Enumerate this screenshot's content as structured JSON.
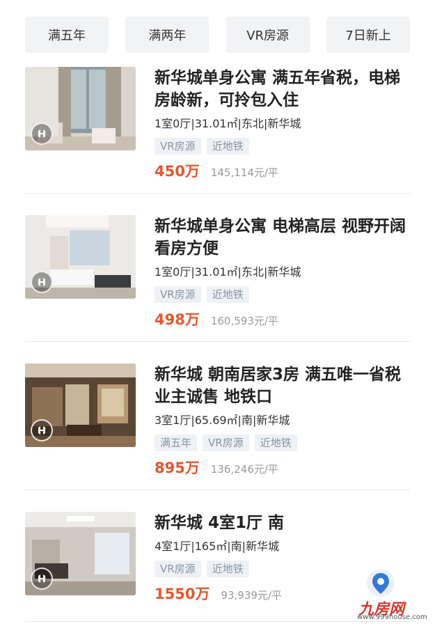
{
  "filters": [
    "满五年",
    "满两年",
    "VR房源",
    "7日新上"
  ],
  "listings": [
    {
      "title": "新华城单身公寓 满五年省税，电梯房龄新，可拎包入住",
      "meta": "1室0厅|31.01㎡|东北|新华城",
      "tags": [
        "VR房源",
        "近地铁"
      ],
      "price": "450万",
      "unit_price": "145,114元/平"
    },
    {
      "title": "新华城单身公寓 电梯高层 视野开阔 看房方便",
      "meta": "1室0厅|31.01㎡|东北|新华城",
      "tags": [
        "VR房源",
        "近地铁"
      ],
      "price": "498万",
      "unit_price": "160,593元/平"
    },
    {
      "title": "新华城 朝南居家3房 满五唯一省税 业主诚售 地铁口",
      "meta": "3室1厅|65.69㎡|南|新华城",
      "tags": [
        "满五年",
        "VR房源",
        "近地铁"
      ],
      "price": "895万",
      "unit_price": "136,246元/平"
    },
    {
      "title": "新华城 4室1厅 南",
      "meta": "4室1厅|165㎡|南|新华城",
      "tags": [
        "VR房源",
        "近地铁"
      ],
      "price": "1550万",
      "unit_price": "93,939元/平"
    }
  ],
  "watermark": {
    "brand": "九房网",
    "url": "www.999house.com"
  },
  "colors": {
    "price": "#e4572e",
    "tag_bg": "#eef1f5",
    "tag_text": "#8a95a5",
    "filter_bg": "#f2f3f5"
  }
}
